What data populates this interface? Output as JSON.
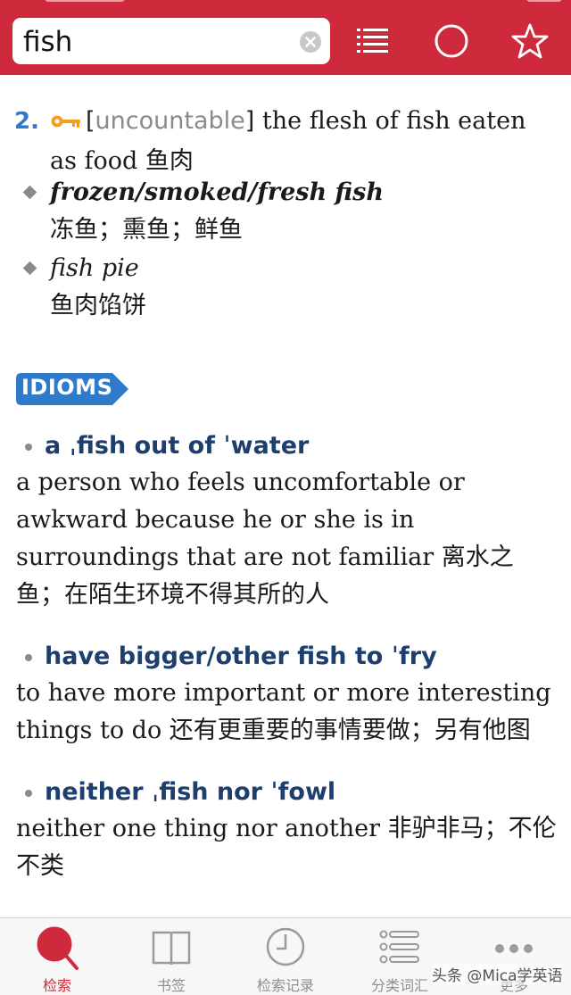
{
  "search": {
    "value": "fish"
  },
  "sense": {
    "number": "2.",
    "grammar_open": "[",
    "grammar": "uncountable",
    "grammar_close": "]",
    "definition": "the flesh of fish eaten as food",
    "definition_zh": "鱼肉",
    "examples": [
      {
        "en": "frozen/smoked/fresh fish",
        "zh": "冻鱼；熏鱼；鲜鱼"
      },
      {
        "en": "fish pie",
        "zh": "鱼肉馅饼"
      }
    ]
  },
  "idioms_label": "IDIOMS",
  "idioms": [
    {
      "headword": "a ˌfish out of ˈwater",
      "definition": "a person who feels uncomfortable or awkward because he or she is in surroundings that are not familiar 离水之鱼；在陌生环境不得其所的人"
    },
    {
      "headword": "have bigger/other fish to ˈfry",
      "definition": "to have more important or more interesting things to do 还有更重要的事情要做；另有他图"
    },
    {
      "headword": "neither ˌfish nor ˈfowl",
      "definition": "neither one thing nor another 非驴非马；不伦不类"
    }
  ],
  "tabs": [
    {
      "label": "检索",
      "icon": "search-icon",
      "active": true
    },
    {
      "label": "书签",
      "icon": "book-icon",
      "active": false
    },
    {
      "label": "检索记录",
      "icon": "clock-icon",
      "active": false
    },
    {
      "label": "分类词汇",
      "icon": "list-icon",
      "active": false
    },
    {
      "label": "更多",
      "icon": "more-icon",
      "active": false
    }
  ],
  "watermark": "头条 @Mica学英语",
  "colors": {
    "accent": "#cf2a3b",
    "sense_number": "#2f7acb",
    "idiom_head": "#1e3f6e",
    "badge": "#2f7acb"
  }
}
